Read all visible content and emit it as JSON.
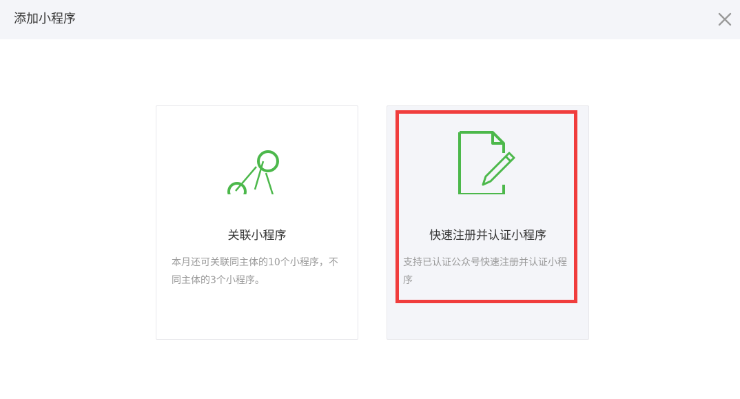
{
  "dialog": {
    "title": "添加小程序",
    "close_icon": "close-icon"
  },
  "cards": {
    "relate": {
      "icon": "share-nodes-icon",
      "title": "关联小程序",
      "description": "本月还可关联同主体的10个小程序，不同主体的3个小程序。"
    },
    "register": {
      "icon": "document-edit-icon",
      "title": "快速注册并认证小程序",
      "description": "支持已认证公众号快速注册并认证小程序"
    }
  },
  "colors": {
    "accent_green": "#4cb84b",
    "highlight_red": "#f03d3d",
    "header_bg": "#f4f5f9"
  }
}
